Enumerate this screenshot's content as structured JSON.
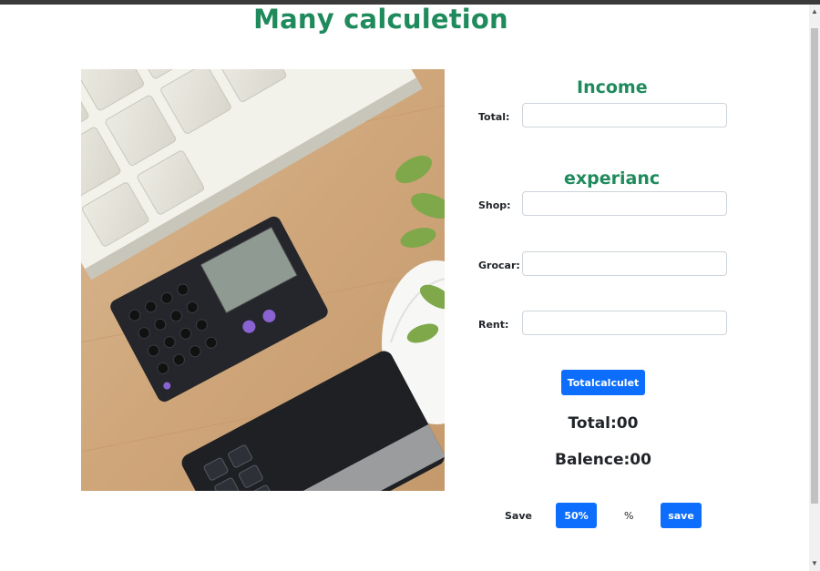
{
  "page": {
    "title": "Many calculetion"
  },
  "income": {
    "heading": "Income",
    "total_label": "Total:",
    "total_value": ""
  },
  "expense": {
    "heading": "experianc",
    "shop_label": "Shop:",
    "shop_value": "",
    "grocar_label": "Grocar:",
    "grocar_value": "",
    "rent_label": "Rent:",
    "rent_value": ""
  },
  "actions": {
    "calculate_label": "Totalcalculet",
    "save_text": "Save",
    "percent_button_label": "50%",
    "percent_symbol": "%",
    "save_button_label": "save"
  },
  "results": {
    "total_text": "Total:00",
    "balance_text": "Balence:00"
  },
  "colors": {
    "heading_green": "#1f8a5b",
    "button_blue": "#0d6efd"
  }
}
